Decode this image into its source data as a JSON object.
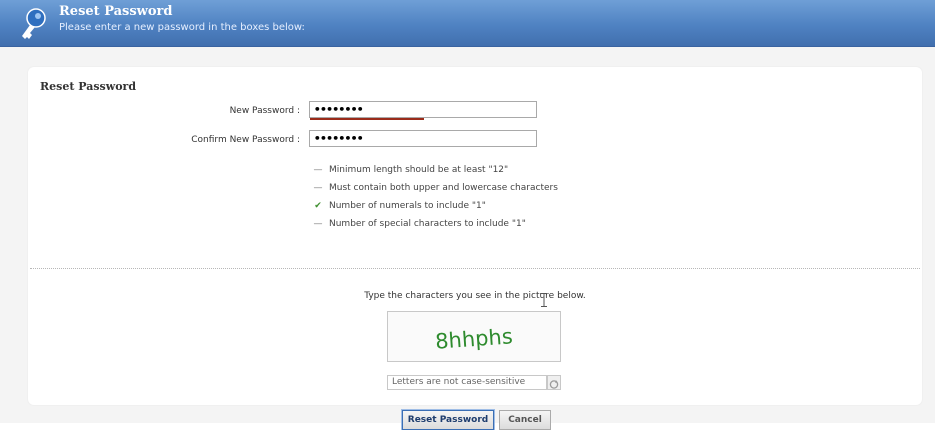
{
  "header": {
    "title": "Reset Password",
    "subtitle": "Please enter a new password in the boxes below:",
    "icon": "key-icon",
    "bg_color": "#4f82c2"
  },
  "form": {
    "section_title": "Reset Password",
    "new_password": {
      "label": "New Password :",
      "value": "••••••••"
    },
    "confirm_password": {
      "label": "Confirm New Password :",
      "value": "••••••••"
    },
    "strength_color": "#9a2b1a",
    "rules": [
      {
        "status": "pending",
        "mark": "—",
        "text": "Minimum length should be at least \"12\""
      },
      {
        "status": "pending",
        "mark": "—",
        "text": "Must contain both upper and lowercase characters"
      },
      {
        "status": "met",
        "mark": "✔",
        "text": "Number of numerals to include \"1\""
      },
      {
        "status": "pending",
        "mark": "—",
        "text": "Number of special characters to include \"1\""
      }
    ]
  },
  "captcha": {
    "prompt": "Type the characters you see in the picture below.",
    "image_text": "8hhphs",
    "image_text_color": "#2e8b2e",
    "input_placeholder": "Letters are not case-sensitive",
    "refresh_icon": "refresh-icon"
  },
  "buttons": {
    "reset_label": "Reset Password",
    "cancel_label": "Cancel"
  }
}
